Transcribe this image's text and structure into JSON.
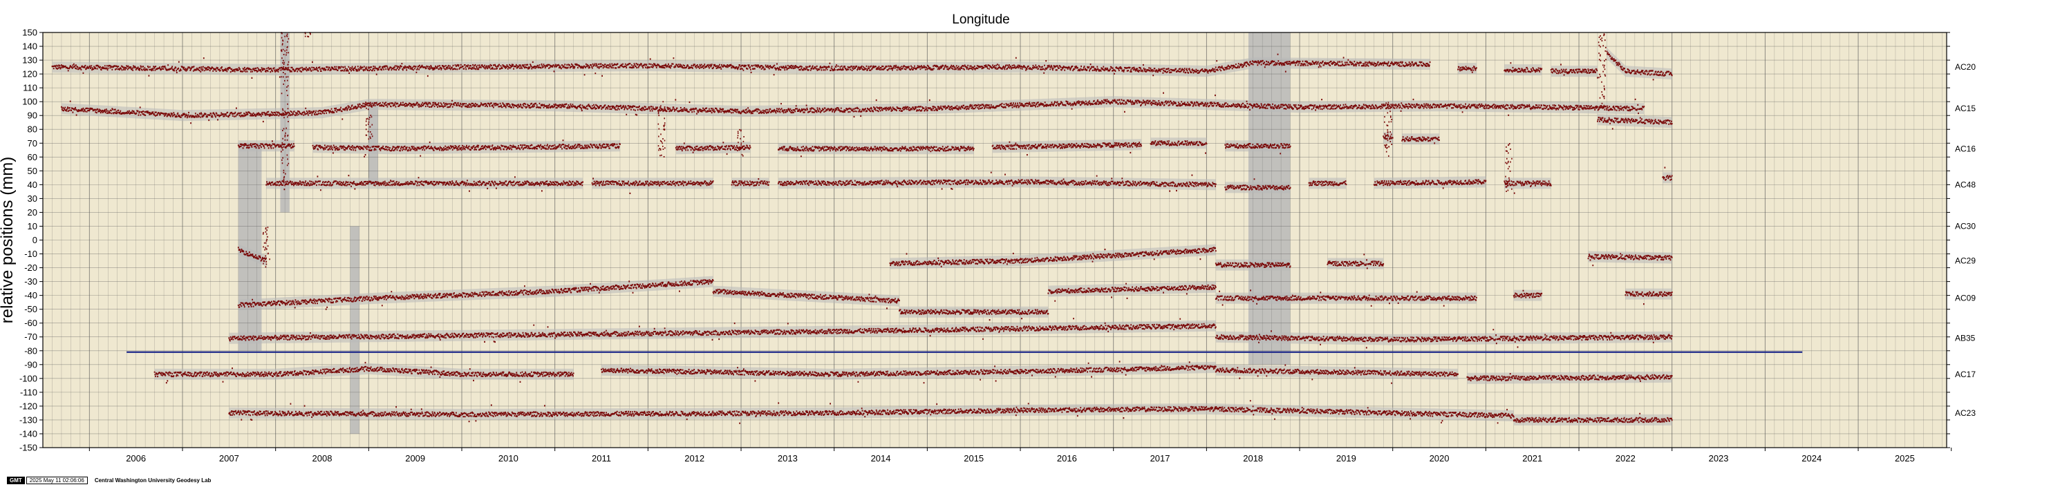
{
  "chart_data": {
    "type": "scatter",
    "title": "Longitude",
    "ylabel": "relative positions (mm)",
    "xlabel": "",
    "xlim": [
      2005.5,
      2025.95
    ],
    "ylim": [
      -150,
      150
    ],
    "x_tick_labels": [
      "2006",
      "2007",
      "2008",
      "2009",
      "2010",
      "2011",
      "2012",
      "2013",
      "2014",
      "2015",
      "2016",
      "2017",
      "2018",
      "2019",
      "2020",
      "2021",
      "2022",
      "2023",
      "2024",
      "2025"
    ],
    "y_tick_labels": [
      "150",
      "140",
      "130",
      "120",
      "110",
      "100",
      "90",
      "80",
      "70",
      "60",
      "50",
      "40",
      "30",
      "20",
      "10",
      "0",
      "-10",
      "-20",
      "-30",
      "-40",
      "-50",
      "-60",
      "-70",
      "-80",
      "-90",
      "-100",
      "-110",
      "-120",
      "-130",
      "-140",
      "-150"
    ],
    "grid": true,
    "reference_line": {
      "y": -81,
      "x_start": 2006.4,
      "x_end": 2024.4,
      "color": "#1f2a8a"
    },
    "series": [
      {
        "name": "AC20",
        "offset": 125,
        "segments": [
          [
            2005.6,
            2020.4,
            [
              [
                2005.6,
                0
              ],
              [
                2008.0,
                -2
              ],
              [
                2010.0,
                0
              ],
              [
                2012.0,
                1
              ],
              [
                2014.0,
                -1
              ],
              [
                2016.0,
                0
              ],
              [
                2018.0,
                -3
              ],
              [
                2018.5,
                3
              ],
              [
                2020.4,
                2
              ]
            ]
          ],
          [
            2020.7,
            2020.9,
            [
              [
                2020.7,
                -1
              ]
            ]
          ],
          [
            2021.2,
            2021.6,
            [
              [
                2021.2,
                -2
              ]
            ]
          ],
          [
            2021.7,
            2022.2,
            [
              [
                2021.7,
                -3
              ]
            ]
          ],
          [
            2022.3,
            2023.0,
            [
              [
                2022.3,
                10
              ],
              [
                2022.5,
                -3
              ],
              [
                2023.0,
                -5
              ]
            ]
          ]
        ]
      },
      {
        "name": "AC15",
        "offset": 95,
        "segments": [
          [
            2005.7,
            2022.7,
            [
              [
                2005.7,
                0
              ],
              [
                2007.0,
                -5
              ],
              [
                2008.5,
                -3
              ],
              [
                2009.0,
                3
              ],
              [
                2011.0,
                2
              ],
              [
                2013.0,
                -2
              ],
              [
                2015.0,
                0
              ],
              [
                2017.0,
                5
              ],
              [
                2019.0,
                1
              ],
              [
                2020.5,
                2
              ],
              [
                2022.7,
                0
              ]
            ]
          ],
          [
            2022.2,
            2023.0,
            [
              [
                2022.2,
                -8
              ],
              [
                2023.0,
                -10
              ]
            ]
          ]
        ]
      },
      {
        "name": "AC16",
        "offset": 66,
        "segments": [
          [
            2007.6,
            2008.2,
            [
              [
                2007.6,
                2
              ]
            ]
          ],
          [
            2008.4,
            2009.3,
            [
              [
                2008.4,
                1
              ],
              [
                2009.3,
                0
              ]
            ]
          ],
          [
            2009.3,
            2011.7,
            [
              [
                2009.3,
                0
              ],
              [
                2011.7,
                2
              ]
            ]
          ],
          [
            2012.3,
            2013.1,
            [
              [
                2012.3,
                0
              ],
              [
                2013.1,
                1
              ]
            ]
          ],
          [
            2013.4,
            2015.5,
            [
              [
                2013.4,
                0
              ],
              [
                2015.5,
                0
              ]
            ]
          ],
          [
            2015.7,
            2017.3,
            [
              [
                2015.7,
                1
              ],
              [
                2017.3,
                3
              ]
            ]
          ],
          [
            2017.4,
            2018.0,
            [
              [
                2017.4,
                4
              ]
            ]
          ],
          [
            2018.2,
            2018.9,
            [
              [
                2018.2,
                2
              ]
            ]
          ],
          [
            2019.9,
            2020.0,
            [
              [
                2019.9,
                8
              ]
            ]
          ],
          [
            2020.1,
            2020.5,
            [
              [
                2020.1,
                7
              ]
            ]
          ]
        ]
      },
      {
        "name": "AC48",
        "offset": 40,
        "segments": [
          [
            2007.9,
            2011.3,
            [
              [
                2007.9,
                1
              ],
              [
                2011.3,
                1
              ]
            ]
          ],
          [
            2011.4,
            2012.7,
            [
              [
                2011.4,
                1
              ]
            ]
          ],
          [
            2012.9,
            2013.3,
            [
              [
                2012.9,
                1
              ]
            ]
          ],
          [
            2013.4,
            2018.1,
            [
              [
                2013.4,
                1
              ],
              [
                2016.0,
                2
              ],
              [
                2018.1,
                0
              ]
            ]
          ],
          [
            2018.2,
            2018.9,
            [
              [
                2018.2,
                -2
              ]
            ]
          ],
          [
            2019.1,
            2019.5,
            [
              [
                2019.1,
                1
              ]
            ]
          ],
          [
            2019.8,
            2021.0,
            [
              [
                2019.8,
                1
              ],
              [
                2021.0,
                2
              ]
            ]
          ],
          [
            2021.2,
            2021.7,
            [
              [
                2021.2,
                1
              ]
            ]
          ],
          [
            2022.9,
            2023.0,
            [
              [
                2022.9,
                5
              ]
            ]
          ]
        ]
      },
      {
        "name": "AC30",
        "offset": 10,
        "segments": []
      },
      {
        "name": "AC29",
        "offset": -15,
        "segments": [
          [
            2007.6,
            2007.9,
            [
              [
                2007.6,
                8
              ],
              [
                2007.9,
                0
              ]
            ]
          ],
          [
            2014.6,
            2018.1,
            [
              [
                2014.6,
                -2
              ],
              [
                2016.0,
                0
              ],
              [
                2018.1,
                8
              ]
            ]
          ],
          [
            2018.1,
            2018.9,
            [
              [
                2018.1,
                -3
              ]
            ]
          ],
          [
            2019.3,
            2019.9,
            [
              [
                2019.3,
                -2
              ]
            ]
          ],
          [
            2022.1,
            2023.0,
            [
              [
                2022.1,
                3
              ],
              [
                2023.0,
                2
              ]
            ]
          ]
        ]
      },
      {
        "name": "AC09",
        "offset": -42,
        "segments": [
          [
            2007.6,
            2009.1,
            [
              [
                2007.6,
                -5
              ],
              [
                2009.1,
                0
              ]
            ]
          ],
          [
            2009.1,
            2012.7,
            [
              [
                2009.1,
                0
              ],
              [
                2011.0,
                5
              ],
              [
                2012.7,
                12
              ]
            ]
          ],
          [
            2012.7,
            2014.7,
            [
              [
                2012.7,
                5
              ],
              [
                2014.7,
                -2
              ]
            ]
          ],
          [
            2014.7,
            2016.3,
            [
              [
                2014.7,
                -10
              ],
              [
                2016.0,
                -10
              ]
            ]
          ],
          [
            2016.3,
            2018.1,
            [
              [
                2016.3,
                5
              ],
              [
                2018.1,
                8
              ]
            ]
          ],
          [
            2018.1,
            2020.9,
            [
              [
                2018.1,
                0
              ],
              [
                2020.9,
                0
              ]
            ]
          ],
          [
            2021.3,
            2021.6,
            [
              [
                2021.3,
                2
              ]
            ]
          ],
          [
            2022.5,
            2023.0,
            [
              [
                2022.5,
                3
              ]
            ]
          ]
        ]
      },
      {
        "name": "AB35",
        "offset": -71,
        "segments": [
          [
            2007.5,
            2018.1,
            [
              [
                2007.5,
                0
              ],
              [
                2010.0,
                2
              ],
              [
                2014.0,
                5
              ],
              [
                2018.1,
                9
              ]
            ]
          ],
          [
            2018.1,
            2023.0,
            [
              [
                2018.1,
                1
              ],
              [
                2020.0,
                -1
              ],
              [
                2023.0,
                1
              ]
            ]
          ]
        ]
      },
      {
        "name": "AC17",
        "offset": -97,
        "segments": [
          [
            2006.7,
            2011.2,
            [
              [
                2006.7,
                0
              ],
              [
                2008.0,
                0
              ],
              [
                2009.0,
                4
              ],
              [
                2010.0,
                0
              ],
              [
                2011.2,
                0
              ]
            ]
          ],
          [
            2011.5,
            2018.1,
            [
              [
                2011.5,
                3
              ],
              [
                2014.0,
                0
              ],
              [
                2016.0,
                2
              ],
              [
                2018.1,
                5
              ]
            ]
          ],
          [
            2018.1,
            2020.7,
            [
              [
                2018.1,
                3
              ],
              [
                2020.7,
                0
              ]
            ]
          ],
          [
            2020.8,
            2023.0,
            [
              [
                2020.8,
                -3
              ],
              [
                2023.0,
                -2
              ]
            ]
          ]
        ]
      },
      {
        "name": "AC23",
        "offset": -125,
        "segments": [
          [
            2007.5,
            2021.3,
            [
              [
                2007.5,
                0
              ],
              [
                2010.0,
                -1
              ],
              [
                2014.0,
                0
              ],
              [
                2016.0,
                2
              ],
              [
                2018.0,
                3
              ],
              [
                2021.3,
                -2
              ]
            ]
          ],
          [
            2021.3,
            2023.0,
            [
              [
                2021.3,
                -5
              ],
              [
                2023.0,
                -5
              ]
            ]
          ]
        ]
      }
    ],
    "scatter_spikes": [
      {
        "x": 2008.1,
        "y_from": 40,
        "y_to": 150
      },
      {
        "x": 2008.35,
        "y_from": 145,
        "y_to": 150
      },
      {
        "x": 2009.0,
        "y_from": 70,
        "y_to": 100
      },
      {
        "x": 2012.15,
        "y_from": 60,
        "y_to": 100
      },
      {
        "x": 2013.0,
        "y_from": 60,
        "y_to": 80
      },
      {
        "x": 2019.95,
        "y_from": 60,
        "y_to": 100
      },
      {
        "x": 2021.25,
        "y_from": 35,
        "y_to": 70
      },
      {
        "x": 2022.25,
        "y_from": 95,
        "y_to": 150
      },
      {
        "x": 2007.9,
        "y_from": -20,
        "y_to": 10
      }
    ],
    "uncertainty_bands": [
      {
        "x_from": 2007.6,
        "x_to": 2007.85,
        "y_from": -80,
        "y_to": 70
      },
      {
        "x_from": 2008.05,
        "x_to": 2008.15,
        "y_from": 20,
        "y_to": 150
      },
      {
        "x_from": 2008.8,
        "x_to": 2008.9,
        "y_from": -140,
        "y_to": 10
      },
      {
        "x_from": 2009.0,
        "x_to": 2009.1,
        "y_from": 40,
        "y_to": 100
      },
      {
        "x_from": 2018.45,
        "x_to": 2018.9,
        "y_from": -90,
        "y_to": 150
      }
    ],
    "colors": {
      "plot_bg": "#efe8d0",
      "marker": "#7a0a0a",
      "band": "#b8b8b8",
      "grid": "#555555",
      "ref_line": "#1f2a8a"
    }
  },
  "footer": {
    "badge": "GMT",
    "timestamp": "2025 May 11 02:06:06",
    "organization": "Central Washington University Geodesy Lab"
  }
}
